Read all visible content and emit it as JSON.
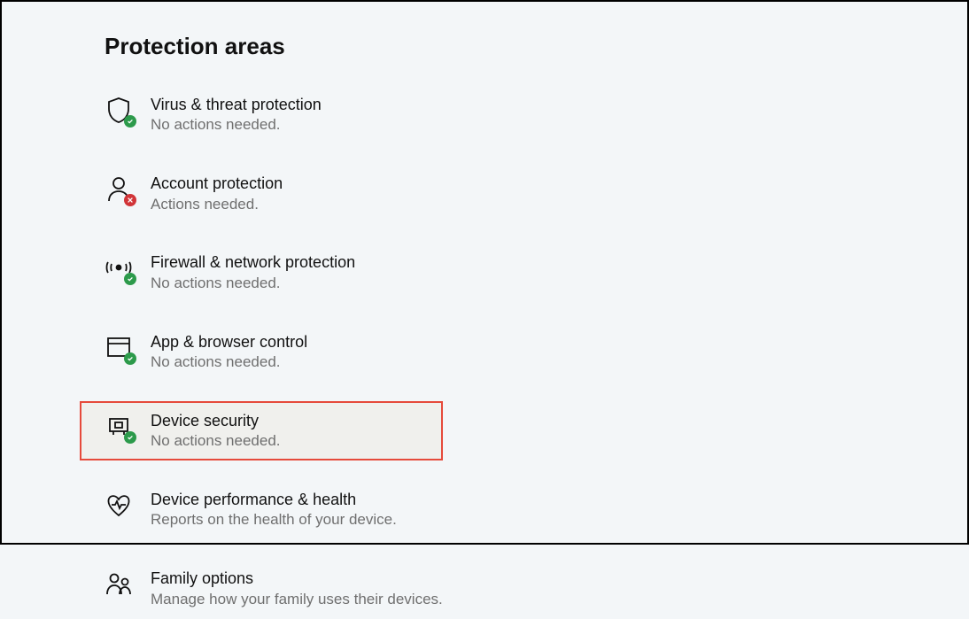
{
  "heading": "Protection areas",
  "areas": [
    {
      "title": "Virus & threat protection",
      "sub": "No actions needed."
    },
    {
      "title": "Account protection",
      "sub": "Actions needed."
    },
    {
      "title": "Firewall & network protection",
      "sub": "No actions needed."
    },
    {
      "title": "App & browser control",
      "sub": "No actions needed."
    },
    {
      "title": "Device security",
      "sub": "No actions needed."
    },
    {
      "title": "Device performance & health",
      "sub": "Reports on the health of your device."
    },
    {
      "title": "Family options",
      "sub": "Manage how your family uses their devices."
    }
  ],
  "highlighted_index": 4,
  "colors": {
    "ok": "#2c9a4b",
    "error": "#d13438",
    "highlight_outline": "#e64a3b"
  }
}
